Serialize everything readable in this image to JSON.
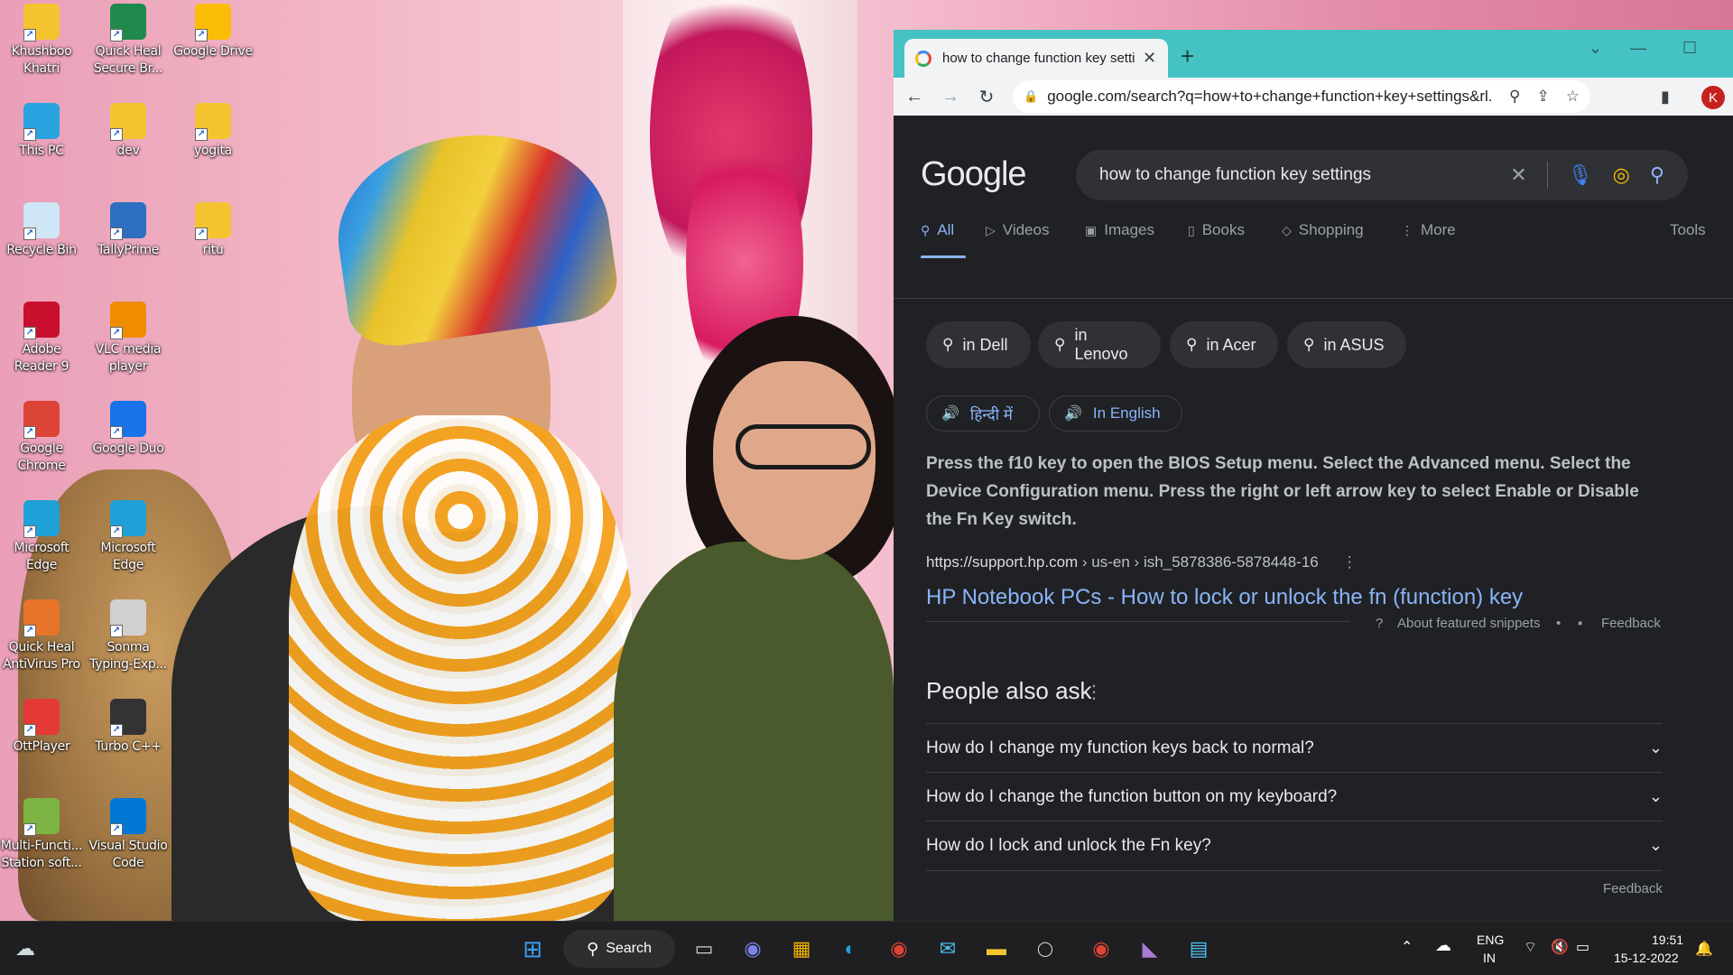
{
  "desktop": {
    "icons": [
      {
        "id": "khushboo",
        "label": "Khushboo Khatri",
        "icon": "folder-icon",
        "color": "#f4c430"
      },
      {
        "id": "quickheal-secure",
        "label": "Quick Heal Secure Br...",
        "icon": "quick-heal-secure-browser-icon",
        "color": "#1f8a4c"
      },
      {
        "id": "gdrive",
        "label": "Google Drive",
        "icon": "google-drive-icon",
        "color": "#fbbc05"
      },
      {
        "id": "thispc",
        "label": "This PC",
        "icon": "computer-icon",
        "color": "#29a3e0"
      },
      {
        "id": "dev",
        "label": "dev",
        "icon": "folder-icon",
        "color": "#f4c430"
      },
      {
        "id": "yogita",
        "label": "yogita",
        "icon": "folder-icon",
        "color": "#f4c430"
      },
      {
        "id": "recycle",
        "label": "Recycle Bin",
        "icon": "recycle-bin-icon",
        "color": "#cfe6f6"
      },
      {
        "id": "tally",
        "label": "TallyPrime",
        "icon": "tallyprime-icon",
        "color": "#2c6fc1"
      },
      {
        "id": "ritu",
        "label": "ritu",
        "icon": "folder-icon",
        "color": "#f4c430"
      },
      {
        "id": "adobe",
        "label": "Adobe Reader 9",
        "icon": "adobe-reader-icon",
        "color": "#c8102e"
      },
      {
        "id": "vlc",
        "label": "VLC media player",
        "icon": "vlc-icon",
        "color": "#f08c00"
      },
      {
        "id": "chrome",
        "label": "Google Chrome",
        "icon": "chrome-icon",
        "color": "#db4437"
      },
      {
        "id": "duo",
        "label": "Google Duo",
        "icon": "google-duo-icon",
        "color": "#1a73e8"
      },
      {
        "id": "edge1",
        "label": "Microsoft Edge",
        "icon": "edge-icon",
        "color": "#1fa0d8"
      },
      {
        "id": "edge2",
        "label": "Microsoft Edge",
        "icon": "edge-icon",
        "color": "#1fa0d8"
      },
      {
        "id": "qh-av",
        "label": "Quick Heal AntiVirus Pro",
        "icon": "quick-heal-antivirus-icon",
        "color": "#e8742a"
      },
      {
        "id": "sonma",
        "label": "Sonma Typing-Exp...",
        "icon": "sonma-typing-icon",
        "color": "#d0d0d0"
      },
      {
        "id": "ott",
        "label": "OttPlayer",
        "icon": "ottplayer-icon",
        "color": "#e53935"
      },
      {
        "id": "turbo",
        "label": "Turbo C++",
        "icon": "turbo-cpp-icon",
        "color": "#333333"
      },
      {
        "id": "multi",
        "label": "Multi-Functi... Station soft...",
        "icon": "multi-function-station-icon",
        "color": "#7cb342"
      },
      {
        "id": "vscode",
        "label": "Visual Studio Code",
        "icon": "vscode-icon",
        "color": "#0078d4"
      }
    ]
  },
  "browser": {
    "tab_title": "how to change function key setti",
    "url": "google.com/search?q=how+to+change+function+key+settings&rl...",
    "avatar_letter": "K",
    "accent": "#45c2c4"
  },
  "search": {
    "logo": "Google",
    "query": "how to change function key settings",
    "tabs": [
      {
        "label": "All",
        "icon": "search-icon"
      },
      {
        "label": "Videos",
        "icon": "video-icon"
      },
      {
        "label": "Images",
        "icon": "image-icon"
      },
      {
        "label": "Books",
        "icon": "book-icon"
      },
      {
        "label": "Shopping",
        "icon": "tag-icon"
      },
      {
        "label": "More",
        "icon": "more-vert-icon"
      }
    ],
    "tools": "Tools",
    "chips": [
      "in Dell",
      "in Lenovo",
      "in Acer",
      "in ASUS"
    ],
    "lang_hindi": "हिन्दी में",
    "lang_english": "In English",
    "snippet": "Press the f10 key to open the BIOS Setup menu. Select the Advanced menu. Select the Device Configuration menu. Press the right or left arrow key to select Enable or Disable the Fn Key switch.",
    "source_host": "https://support.hp.com",
    "source_path": " › us-en › ish_5878386-5878448-16",
    "result_title": "HP Notebook PCs - How to lock or unlock the fn (function) key",
    "about_snippets": "About featured snippets",
    "bullet": "•",
    "feedback": "Feedback",
    "paa_title": "People also ask",
    "paa_questions": [
      "How do I change my function keys back to normal?",
      "How do I change the function button on my keyboard?",
      "How do I lock and unlock the Fn key?"
    ],
    "paa_feedback": "Feedback"
  },
  "taskbar": {
    "search_label": "Search",
    "lang_top": "ENG",
    "lang_bottom": "IN",
    "time": "19:51",
    "date": "15-12-2022"
  }
}
